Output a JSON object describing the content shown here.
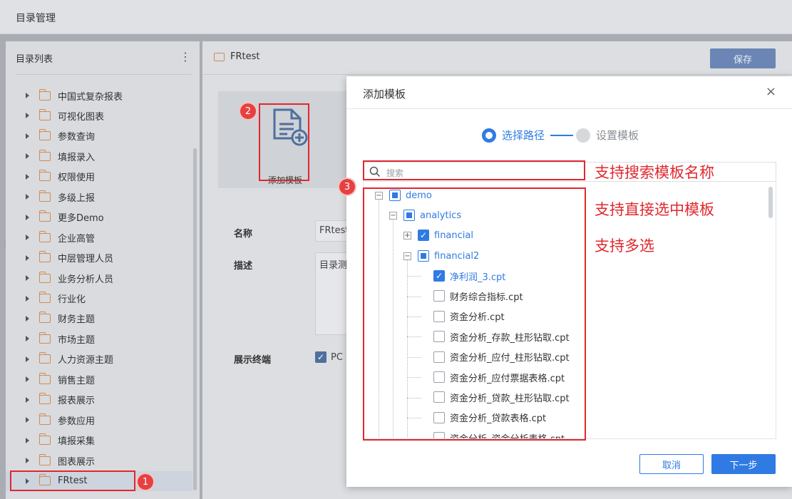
{
  "app": {
    "title": "目录管理"
  },
  "sidebar": {
    "header": "目录列表",
    "more_icon": "⋮",
    "items": [
      {
        "label": "中国式复杂报表"
      },
      {
        "label": "可视化图表"
      },
      {
        "label": "参数查询"
      },
      {
        "label": "填报录入"
      },
      {
        "label": "权限使用"
      },
      {
        "label": "多级上报"
      },
      {
        "label": "更多Demo"
      },
      {
        "label": "企业高管"
      },
      {
        "label": "中层管理人员"
      },
      {
        "label": "业务分析人员"
      },
      {
        "label": "行业化"
      },
      {
        "label": "财务主题"
      },
      {
        "label": "市场主题"
      },
      {
        "label": "人力资源主题"
      },
      {
        "label": "销售主题"
      },
      {
        "label": "报表展示"
      },
      {
        "label": "参数应用"
      },
      {
        "label": "填报采集"
      },
      {
        "label": "图表展示"
      },
      {
        "label": "FRtest"
      }
    ]
  },
  "main": {
    "breadcrumb": "FRtest",
    "save_label": "保存",
    "add_template_label": "添加模板",
    "name_label": "名称",
    "name_value": "FRtest",
    "desc_label": "描述",
    "desc_value": "目录测",
    "terminal_label": "展示终端",
    "terminal_pc": "PC"
  },
  "modal": {
    "title": "添加模板",
    "close": "×",
    "steps": [
      {
        "label": "选择路径",
        "state": "active"
      },
      {
        "label": "设置模板",
        "state": "inactive"
      }
    ],
    "search_placeholder": "搜索",
    "tree": {
      "demo": "demo",
      "analytics": "analytics",
      "financial": "financial",
      "financial2": "financial2",
      "files": [
        {
          "name": "净利润_3.cpt",
          "checked": true
        },
        {
          "name": "财务综合指标.cpt",
          "checked": false
        },
        {
          "name": "资金分析.cpt",
          "checked": false
        },
        {
          "name": "资金分析_存款_柱形钻取.cpt",
          "checked": false
        },
        {
          "name": "资金分析_应付_柱形钻取.cpt",
          "checked": false
        },
        {
          "name": "资金分析_应付票据表格.cpt",
          "checked": false
        },
        {
          "name": "资金分析_贷款_柱形钻取.cpt",
          "checked": false
        },
        {
          "name": "资金分析_贷款表格.cpt",
          "checked": false
        },
        {
          "name": "资金分析_资金分析表格.cpt",
          "checked": false
        }
      ]
    },
    "cancel_label": "取消",
    "next_label": "下一步"
  },
  "annotations": {
    "badge1": "1",
    "badge2": "2",
    "badge3": "3",
    "note_search": "支持搜索模板名称",
    "note_select": "支持直接选中模板",
    "note_multi": "支持多选"
  },
  "colors": {
    "accent": "#2f7be3",
    "annotation": "#e0282e",
    "folder": "#d18b55"
  }
}
